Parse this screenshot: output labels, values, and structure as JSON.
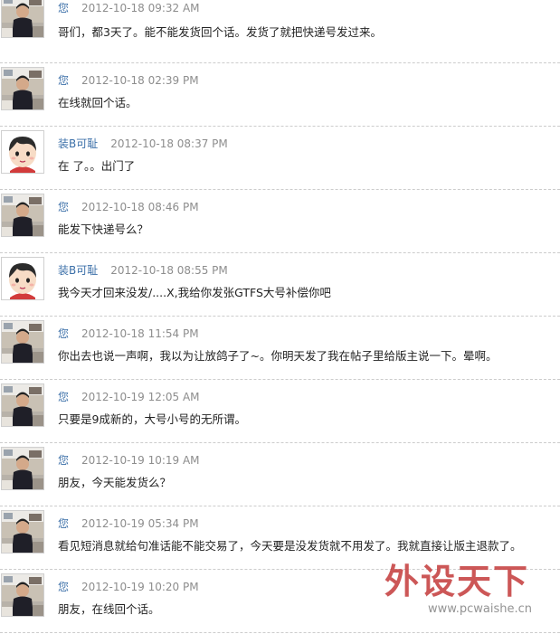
{
  "messages": [
    {
      "sender": "您",
      "avatar": "user-photo",
      "time": "2012-10-18 09:32 AM",
      "text": "哥们，都3天了。能不能发货回个话。发货了就把快递号发过来。"
    },
    {
      "sender": "您",
      "avatar": "user-photo",
      "time": "2012-10-18 02:39 PM",
      "text": "在线就回个话。"
    },
    {
      "sender": "装B可耻",
      "avatar": "cartoon-boy",
      "time": "2012-10-18 08:37 PM",
      "text": "在 了。。出门了"
    },
    {
      "sender": "您",
      "avatar": "user-photo",
      "time": "2012-10-18 08:46 PM",
      "text": "能发下快递号么？"
    },
    {
      "sender": "装B可耻",
      "avatar": "cartoon-boy",
      "time": "2012-10-18 08:55 PM",
      "text": "我今天才回来没发/....X,我给你发张GTFS大号补偿你吧"
    },
    {
      "sender": "您",
      "avatar": "user-photo",
      "time": "2012-10-18 11:54 PM",
      "text": "你出去也说一声啊，我以为让放鸽子了~。你明天发了我在帖子里给版主说一下。晕啊。"
    },
    {
      "sender": "您",
      "avatar": "user-photo",
      "time": "2012-10-19 12:05 AM",
      "text": "只要是9成新的，大号小号的无所谓。"
    },
    {
      "sender": "您",
      "avatar": "user-photo",
      "time": "2012-10-19 10:19 AM",
      "text": "朋友，今天能发货么？"
    },
    {
      "sender": "您",
      "avatar": "user-photo",
      "time": "2012-10-19 05:34 PM",
      "text": "看见短消息就给句准话能不能交易了，今天要是没发货就不用发了。我就直接让版主退款了。"
    },
    {
      "sender": "您",
      "avatar": "user-photo",
      "time": "2012-10-19 10:20 PM",
      "text": "朋友，在线回个话。"
    }
  ],
  "watermark": {
    "logo": "外设天下",
    "url": "www.pcwaishe.cn"
  },
  "colors": {
    "sender_link": "#3b6fa8",
    "time": "#8d8d8d",
    "text": "#222222",
    "divider": "#cccccc"
  }
}
